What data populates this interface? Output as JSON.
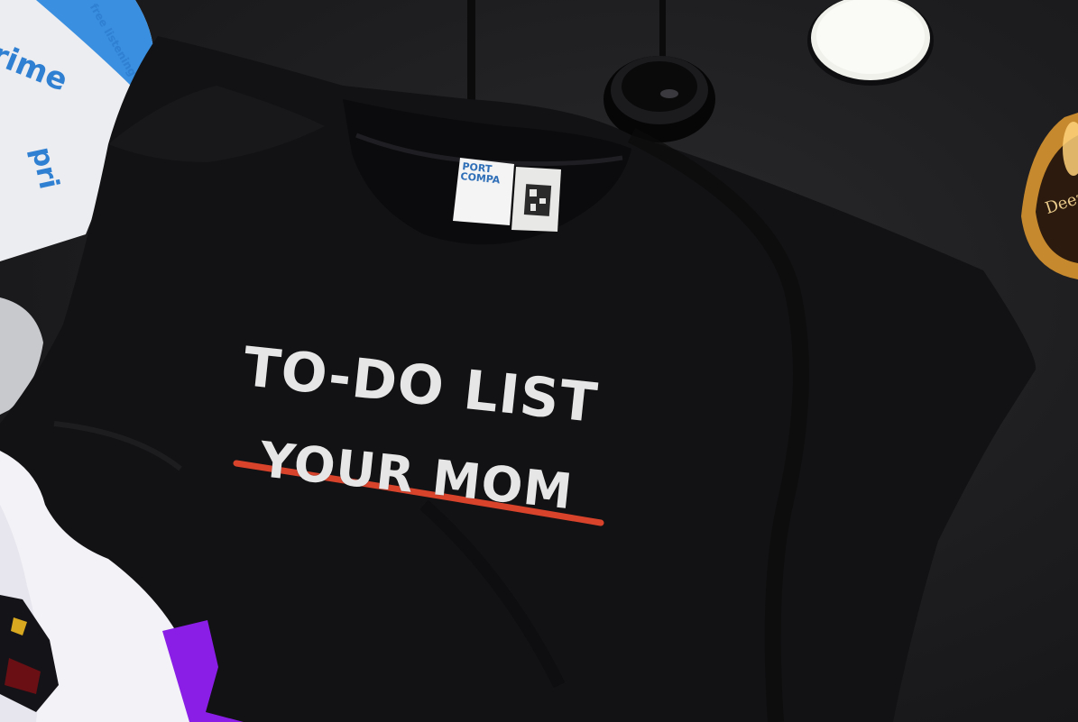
{
  "shirt": {
    "print_line_1": "TO-DO LIST",
    "print_line_2": "YOUR MOM",
    "strike_color": "#d8432c",
    "fabric_color": "#121214"
  },
  "mailer": {
    "brand_fragment_1": "rime",
    "listening_text": "free listening",
    "brand_fragment_2": "pri",
    "accent_color": "#3a8fe0"
  },
  "neck_tag": {
    "line_1": "PORT",
    "line_2": "COMPA"
  },
  "candle_jar": {
    "label_fragment": "Deez"
  },
  "icons": [
    "shirt-icon",
    "candle-icon",
    "lamp-base-icon",
    "jar-lid-icon",
    "mailer-bag-icon",
    "qr-tag-icon"
  ]
}
